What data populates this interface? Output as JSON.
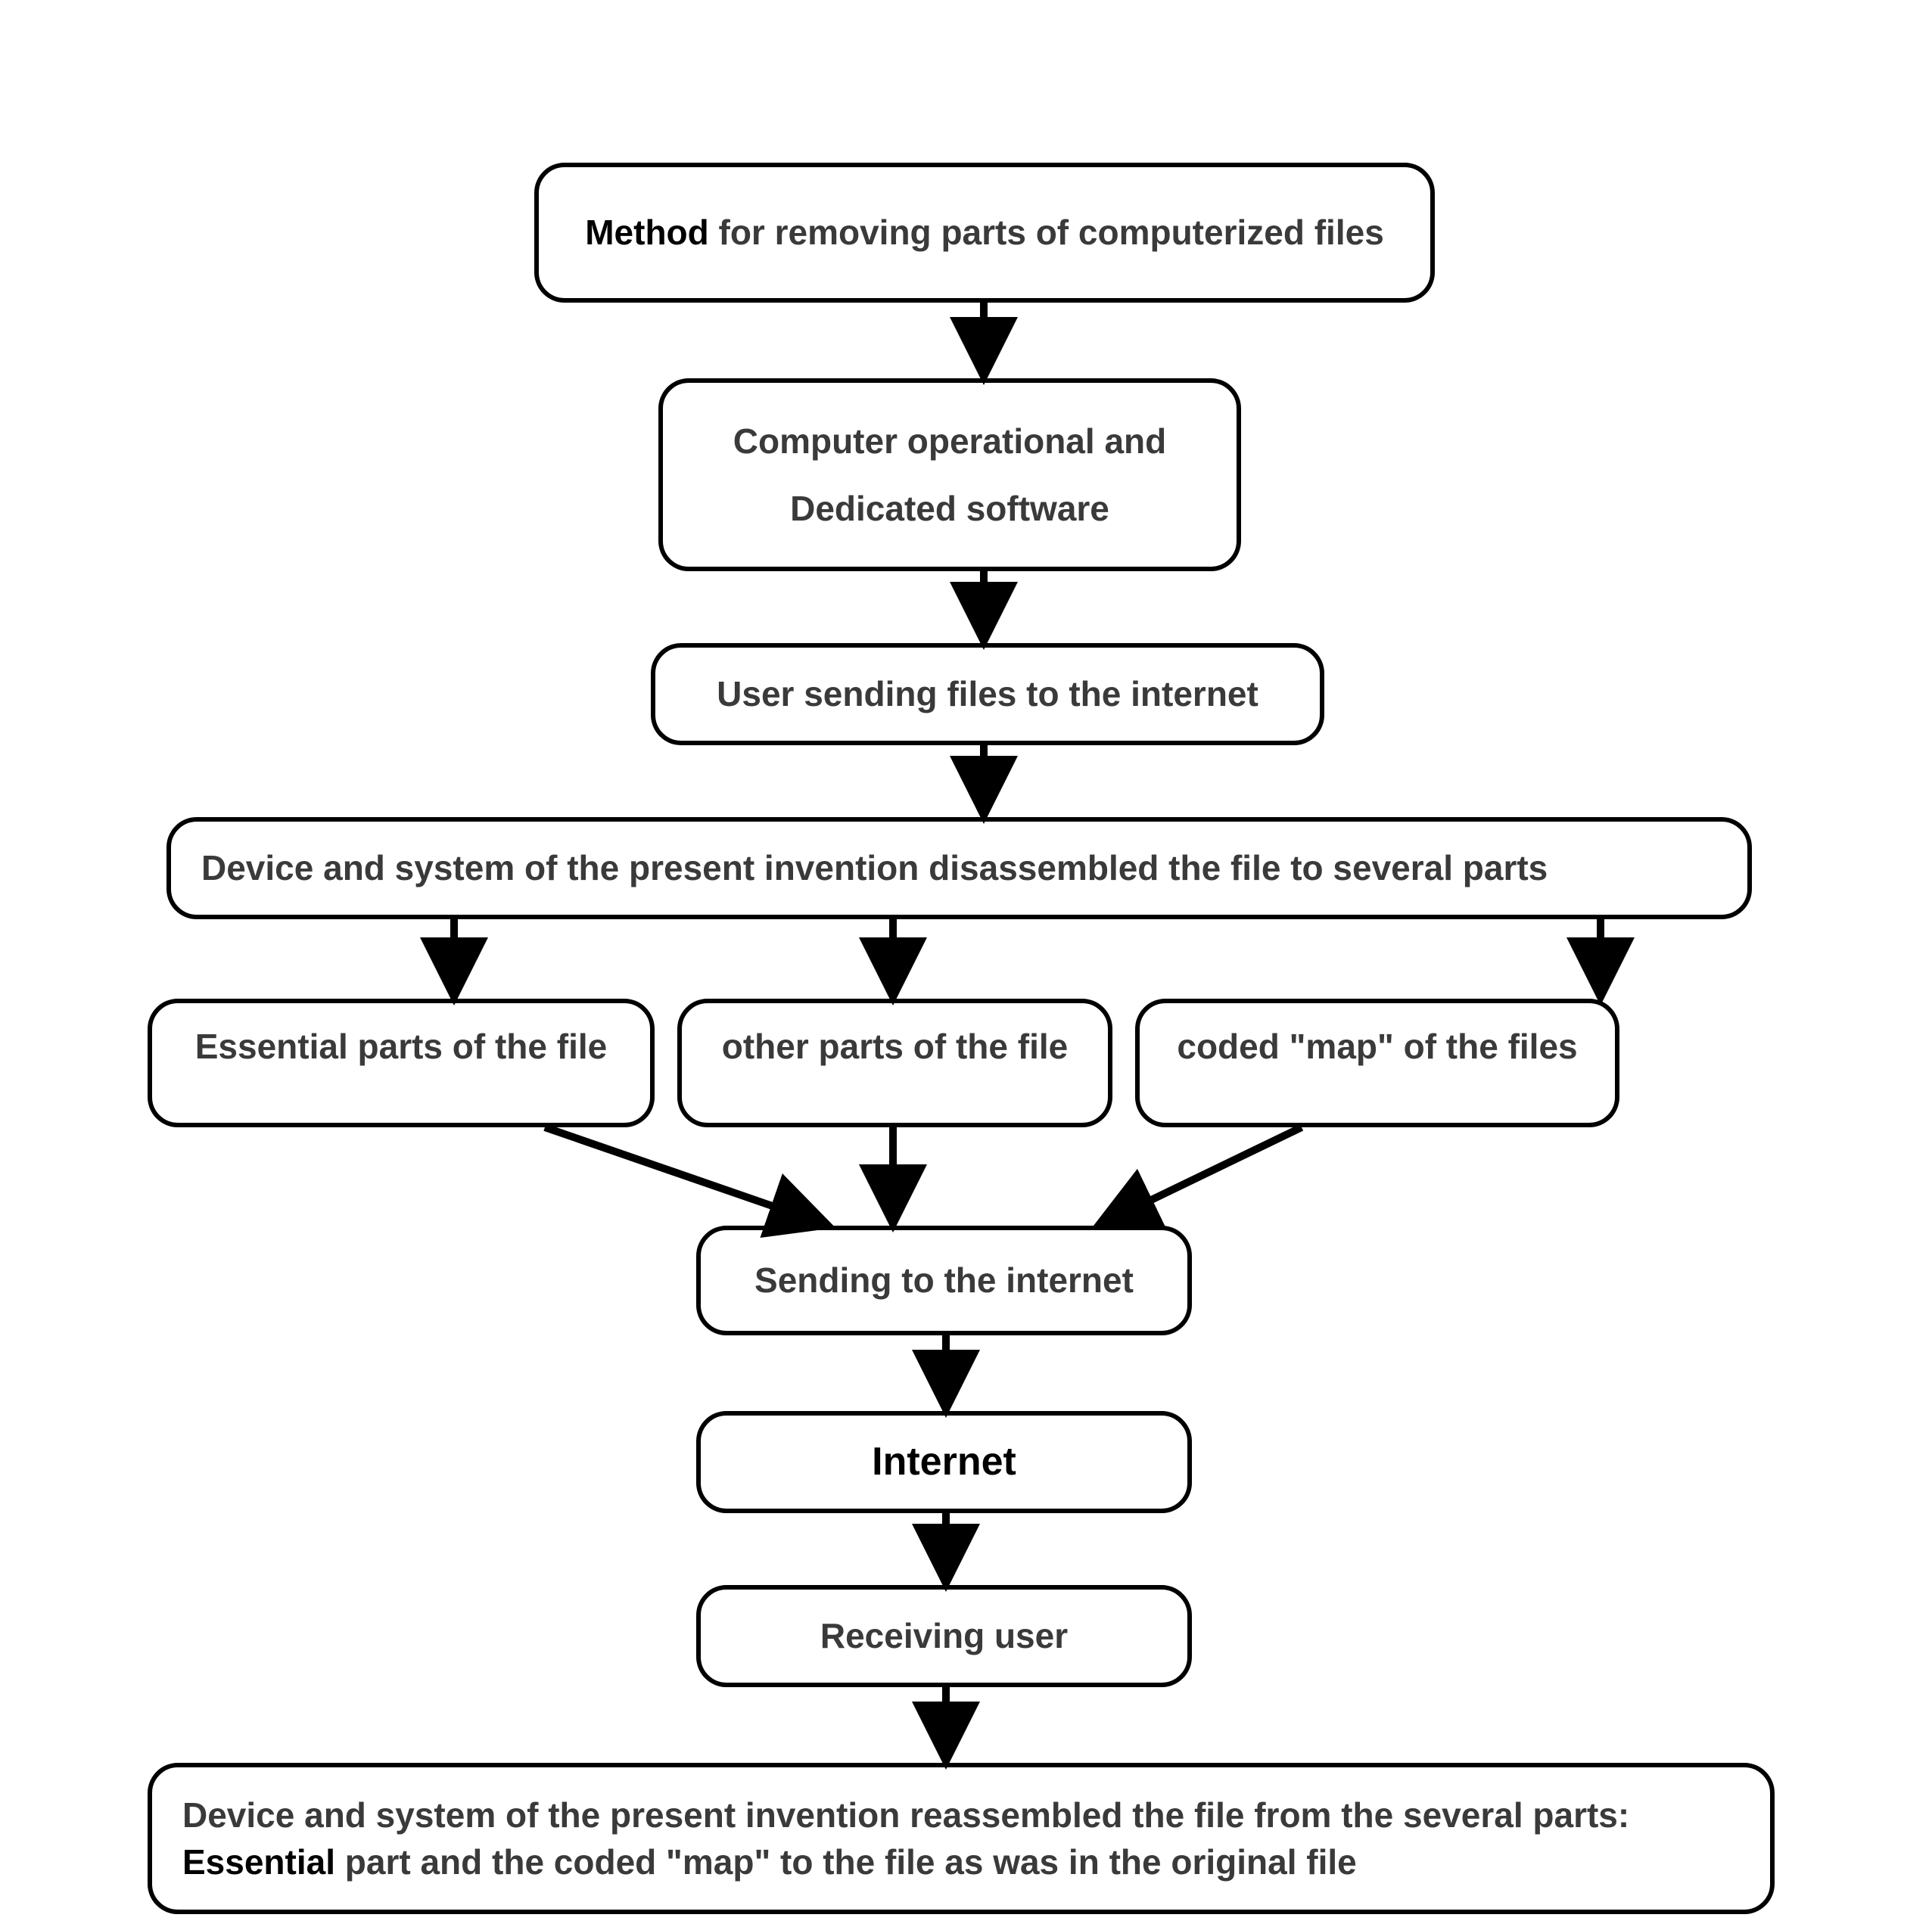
{
  "nodes": {
    "n1_method_prefix": "Method",
    "n1_method_rest": " for removing parts of computerized files",
    "n2_line1": "Computer operational and",
    "n2_line2": "Dedicated software",
    "n3": "User sending files to the internet",
    "n4": "Device and system of the present invention disassembled the file to several parts",
    "n5": "Essential parts of the file",
    "n6": "other parts of the file",
    "n7": "coded \"map\" of the files",
    "n8": "Sending to the internet",
    "n9": "Internet",
    "n10": "Receiving user",
    "n11_a": "Device and system of the present invention reassembled the file from the several parts: ",
    "n11_b": "Essential",
    "n11_c": " part and the coded \"map\" to the file as was in the original file"
  }
}
